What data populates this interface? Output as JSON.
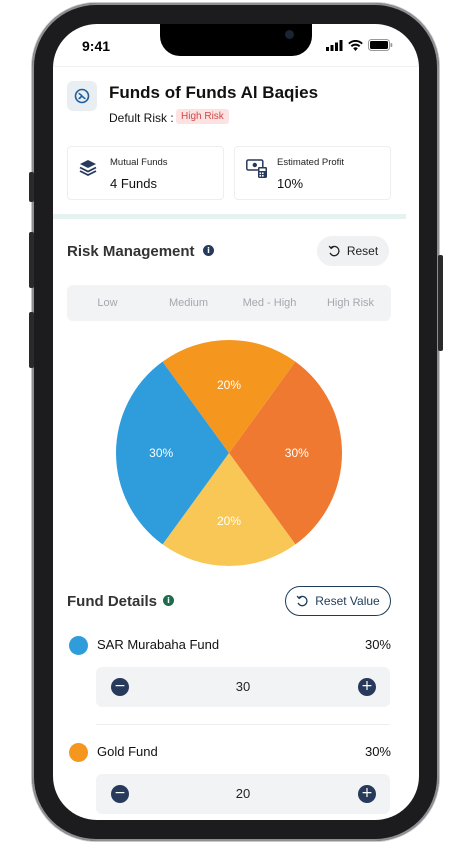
{
  "status": {
    "time": "9:41"
  },
  "header": {
    "logo": "fund-logo-icon",
    "title": "Funds of Funds Al Baqies",
    "risk_label": "Defult Risk :",
    "risk_badge": "High Risk",
    "colors": {
      "badge_bg": "#fde2e2",
      "badge_text": "#d04848"
    }
  },
  "stats": [
    {
      "icon": "layers-icon",
      "label": "Mutual Funds",
      "value": "4 Funds"
    },
    {
      "icon": "cash-calculator-icon",
      "label": "Estimated Profit",
      "value": "10%"
    }
  ],
  "risk_management": {
    "title": "Risk Management",
    "info_icon": "info-icon",
    "reset_label": "Reset",
    "levels": [
      "Low",
      "Medium",
      "Med - High",
      "High Risk"
    ]
  },
  "chart_data": {
    "type": "pie",
    "title": "",
    "slices": [
      {
        "value": 30,
        "label": "30%",
        "color": "#f07931"
      },
      {
        "value": 20,
        "label": "20%",
        "color": "#f8c755"
      },
      {
        "value": 30,
        "label": "30%",
        "color": "#2f9cdb"
      },
      {
        "value": 20,
        "label": "20%",
        "color": "#f5961f"
      }
    ]
  },
  "fund_details": {
    "title": "Fund Details",
    "info_icon": "info-icon",
    "reset_value_label": "Reset Value",
    "funds": [
      {
        "name": "SAR Murabaha Fund",
        "percent": "30%",
        "color": "#2f9cdb",
        "amount": "30"
      },
      {
        "name": "Gold Fund",
        "percent": "30%",
        "color": "#f5961f",
        "amount": "20"
      }
    ]
  }
}
